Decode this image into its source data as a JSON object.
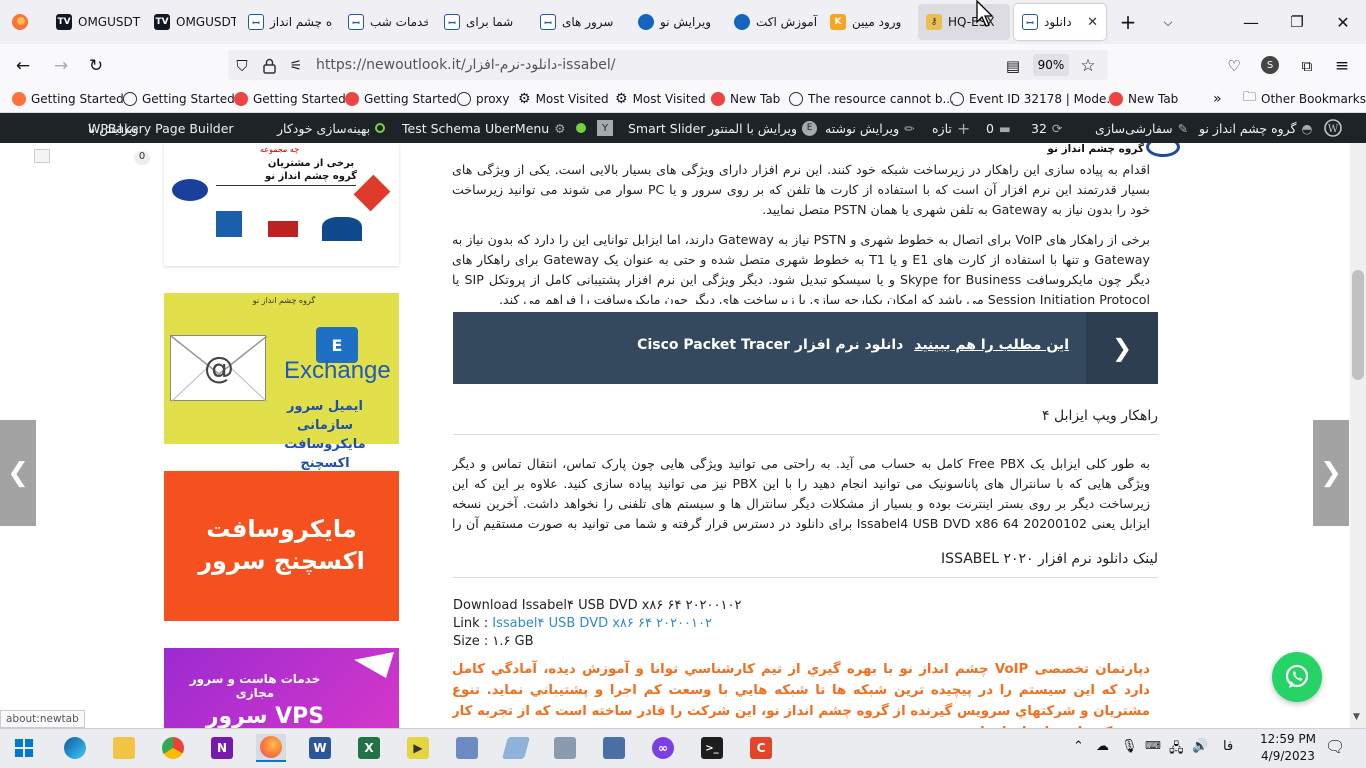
{
  "tabs": [
    {
      "title": "OMGUSDT",
      "icon": "tv-icon"
    },
    {
      "title": "OMGUSDT",
      "icon": "tv-icon"
    },
    {
      "title": "گروه چشم انداز",
      "icon": "edge-icon"
    },
    {
      "title": "خدمات شب",
      "icon": "edge-icon"
    },
    {
      "title": "شما برای",
      "icon": "edge-icon"
    },
    {
      "title": "سرور های",
      "icon": "edge-icon"
    },
    {
      "title": "ویرایش نو",
      "icon": "globe-icon"
    },
    {
      "title": "آموزش اکت",
      "icon": "globe-icon"
    },
    {
      "title": "ورود میین",
      "icon": "k-icon"
    },
    {
      "title": "HQ-ESX",
      "icon": "key-icon"
    },
    {
      "title": "دانلود",
      "icon": "edge-icon"
    }
  ],
  "url": "https://newoutlook.it/دانلود-نرم-افزار-issabel/",
  "zoom": "90%",
  "profile_initial": "S",
  "bookmarks": [
    "Getting Started",
    "Getting Started",
    "Getting Started",
    "Getting Started",
    "proxy",
    "Most Visited",
    "Most Visited",
    "New Tab",
    "The resource cannot b...",
    "Event ID 32178 | Mode...",
    "New Tab"
  ],
  "other_bookmarks": "Other Bookmarks",
  "wpbar": {
    "site": "گروه چشم انداز نو",
    "customize": "سفارشی‌سازی",
    "updates": "32",
    "comments": "0",
    "new": "تازه",
    "edit_post": "ویرایش نوشته",
    "elementor": "ویرایش با المنتور",
    "smart_slider": "Smart Slider",
    "ubermenu": "UberMenu",
    "test_schema": "Test Schema",
    "seo": "بهینه‌سازی خودکار",
    "wpbakery_edit": "ویرایش با",
    "wpbakery": "WPBakery Page Builder"
  },
  "logo_text": "گروه چشم انداز نو",
  "customers_ad": {
    "line1": "برخی از مشتریان",
    "line2": "گروه چشم انداز نو",
    "top": "چه مجموعه"
  },
  "exchange_ad": {
    "header": "گروه چشم انداز نو",
    "word": "Exchange",
    "line1": "ایمیل سرور سازمانی",
    "line2": "مایکروسافت اکسچنج"
  },
  "orange_ad": {
    "line1": "مایکروسافت",
    "line2": "اکسچنج سرور"
  },
  "purple_ad": {
    "line1": "خدمات هاست و سرور مجازی",
    "line2": "VPS سرور مجازی"
  },
  "article": {
    "para1": "اقدام به پیاده سازی این راهکار در زیرساخت شبکه خود کنند. این نرم افزار دارای ویژگی های بسیار بالایی است. یکی از ویژگی های بسیار قدرتمند این نرم افزار آن است که با استفاده از کارت ها تلفن که بر روی سرور و یا PC سوار می شوند می توانید زیرساخت خود را بدون نیاز به Gateway به تلفن شهری یا همان PSTN متصل نمایید.",
    "para2": "برخی از راهکار های VoIP برای اتصال به خطوط شهری و PSTN نیاز به Gateway دارند، اما ایزابل توانایی این را دارد که بدون نیاز به Gateway و تنها با استفاده از کارت های E1 و یا T1 به خطوط شهری متصل شده و حتی به عنوان یک Gateway برای راهکار های دیگر چون مایکروسافت Skype for Business و یا سیسکو تبدیل شود. دیگر ویژگی این نرم افزار پشتیبانی کامل از پروتکل SIP یا Session Initiation Protocol می باشد که امکان یکپارچه سازی با زیرساخت های دیگر چون مایکروسافت را فراهم می کند.",
    "cta_see_also": "این مطلب را هم ببینید",
    "cta_link": "دانلود نرم افزار Cisco Packet Tracer",
    "h_voip": "راهکار ویپ ایزابل ۴",
    "para3": "به طور کلی ایزابل یک Free PBX کامل به حساب می آید. به راحتی می توانید ویژگی هایی چون پارک تماس، انتقال تماس و دیگر ویژگی هایی که با سانترال های پاناسونیک می توانید انجام دهید را با این PBX نیز می توانید پیاده سازی کنید. علاوه بر این که این زیرساخت دیگر بر روی بستر اینترنت بوده و بسیار از مشکلات دیگر سانترال ها و سیستم های تلفنی را نخواهد داشت. آخرین نسخه ایزابل یعنی Issabel4 USB DVD x86 64 20200102 برای دانلود در دسترس قرار گرفته و شما می توانید به صورت مستقیم آن را دانلود کنید.",
    "h_link": "لینک دانلود نرم افزار ISSABEL ۲۰۲۰",
    "download_line": "Download Issabel۴ USB DVD x۸۶ ۶۴ ۲۰۲۰۰۱۰۲",
    "link_label": "Link : ",
    "link_text": "Issabel۴ USB DVD x۸۶ ۶۴ ۲۰۲۰۰۱۰۲",
    "size_line": "Size : ۱.۶ GB",
    "orange_text": "دپارتمان تخصصی VoIP چشم انداز نو با بهره گيري از تيم كارشناسي توانا و آموزش ديده، آمادگي كامل دارد كه اين سيستم را در پيچيده ترين شبكه ها تا شبكه هايي با وسعت كم اجرا و پشتيباني نمايد. تنوع مشتريان و شركتهاي سرويس گيرنده از گروه چشم انداز نو، اين شركت را قادر ساخته است كه از تجربه كار در شبكه هايي با ساختارهاي"
  },
  "left_faded": "0",
  "status_url": "about:newtab",
  "taskbar": {
    "time": "12:59 PM",
    "date": "4/9/2023",
    "lang": "فا"
  },
  "colors": {
    "cta_bg": "#34495e",
    "orange": "#f26f21",
    "wpbar": "#1d2327",
    "whatsapp": "#25d366",
    "link": "#2d8cc9"
  }
}
